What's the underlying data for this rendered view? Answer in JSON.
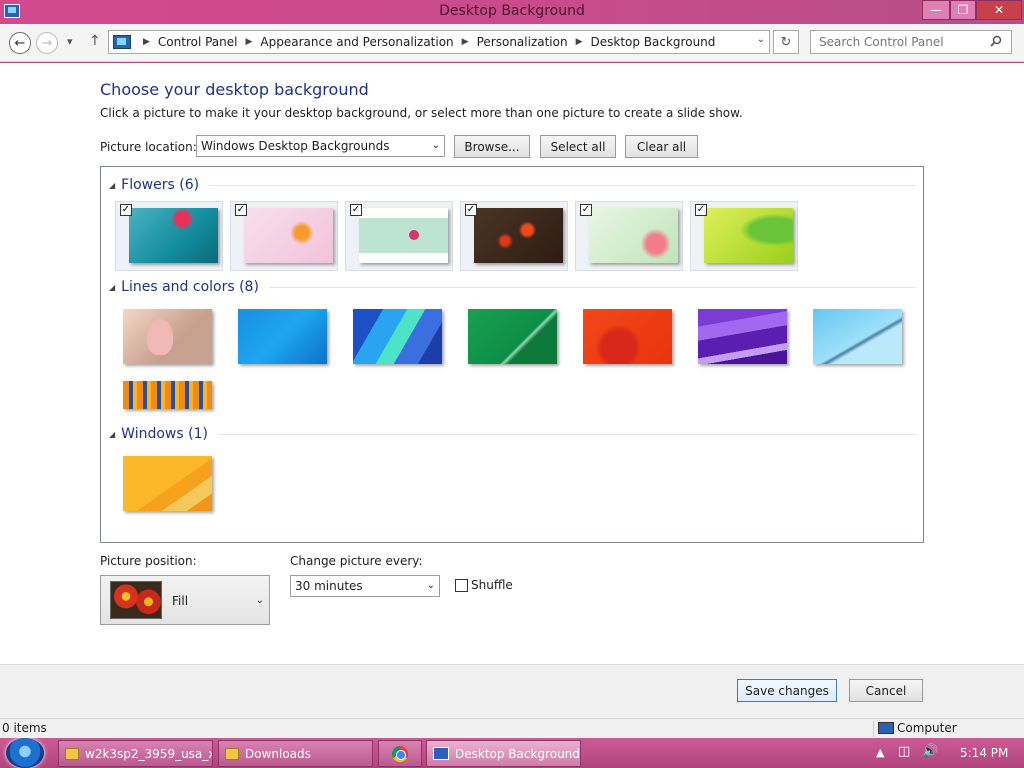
{
  "window": {
    "title": "Desktop Background",
    "controls": {
      "minimize": "—",
      "maximize": "❐",
      "close": "✕"
    }
  },
  "nav": {
    "breadcrumbs": [
      "Control Panel",
      "Appearance and Personalization",
      "Personalization",
      "Desktop Background"
    ],
    "search_placeholder": "Search Control Panel"
  },
  "page": {
    "heading": "Choose your desktop background",
    "subheading": "Click a picture to make it your desktop background, or select more than one picture to create a slide show.",
    "picture_location_label": "Picture location:",
    "picture_location_value": "Windows Desktop Backgrounds",
    "browse_label": "Browse...",
    "select_all_label": "Select all",
    "clear_all_label": "Clear all"
  },
  "groups": [
    {
      "title": "Flowers (6)",
      "items": [
        {
          "style": "f1",
          "checked": true
        },
        {
          "style": "f2",
          "checked": true
        },
        {
          "style": "f3",
          "checked": true
        },
        {
          "style": "f4",
          "checked": true
        },
        {
          "style": "f5",
          "checked": true
        },
        {
          "style": "f6",
          "checked": true
        }
      ]
    },
    {
      "title": "Lines and colors (8)",
      "items": [
        {
          "style": "l1",
          "checked": false
        },
        {
          "style": "l2",
          "checked": false
        },
        {
          "style": "l3",
          "checked": false
        },
        {
          "style": "l4",
          "checked": false
        },
        {
          "style": "l5",
          "checked": false
        },
        {
          "style": "l6",
          "checked": false
        },
        {
          "style": "l7",
          "checked": false
        },
        {
          "style": "l8",
          "checked": false
        }
      ]
    },
    {
      "title": "Windows (1)",
      "items": [
        {
          "style": "w1",
          "checked": false
        }
      ]
    }
  ],
  "options": {
    "picture_position_label": "Picture position:",
    "picture_position_value": "Fill",
    "change_every_label": "Change picture every:",
    "change_every_value": "30 minutes",
    "shuffle_label": "Shuffle"
  },
  "actions": {
    "save_label": "Save changes",
    "cancel_label": "Cancel"
  },
  "status": {
    "items": "0 items",
    "location": "Computer"
  },
  "taskbar": {
    "items": [
      "w2k3sp2_3959_usa_x...",
      "Downloads",
      "Desktop Background"
    ],
    "clock": "5:14 PM"
  },
  "colors": {
    "accent_heading": "#1e3287",
    "titlebar": "#d24a8e",
    "close_button": "#c7414a"
  }
}
